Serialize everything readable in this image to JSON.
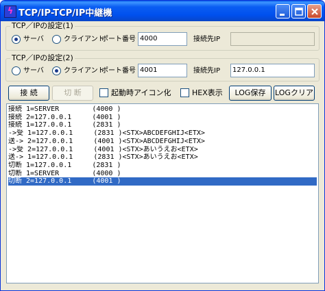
{
  "window": {
    "title": "TCP/IP-TCP/IP中継機",
    "icon": "app-lightning-icon"
  },
  "group1": {
    "legend": "TCP／IPの設定(1)",
    "server_label": "サーバ",
    "client_label": "クライアント",
    "selected": "server",
    "port_label": "ポート番号",
    "port_value": "4000",
    "dest_label": "接続先IP",
    "dest_value": ""
  },
  "group2": {
    "legend": "TCP／IPの設定(2)",
    "server_label": "サーバ",
    "client_label": "クライアント",
    "selected": "client",
    "port_label": "ポート番号",
    "port_value": "4001",
    "dest_label": "接続先IP",
    "dest_value": "127.0.0.1"
  },
  "toolbar": {
    "connect_label": "接 続",
    "disconnect_label": "切 断",
    "startup_icon_label": "起動時アイコン化",
    "startup_icon_checked": false,
    "hex_label": "HEX表示",
    "hex_checked": false,
    "log_save_label": "LOG保存",
    "log_clear_label": "LOGクリア"
  },
  "log": [
    "接続 1=SERVER        (4000 )",
    "接続 2=127.0.0.1     (4001 )",
    "接続 1=127.0.0.1     (2831 )",
    "->受 1=127.0.0.1     (2831 )<STX>ABCDEFGHIJ<ETX>",
    "送-> 2=127.0.0.1     (4001 )<STX>ABCDEFGHIJ<ETX>",
    "->受 2=127.0.0.1     (4001 )<STX>あいうえお<ETX>",
    "送-> 1=127.0.0.1     (2831 )<STX>あいうえお<ETX>",
    "切断 1=127.0.0.1     (2831 )",
    "切断 1=SERVER        (4000 )",
    "切断 2=127.0.0.1     (4001 )"
  ],
  "log_selected_index": 9,
  "colors": {
    "titlebar": "#0054e3",
    "selection": "#316ac5",
    "face": "#ece9d8"
  }
}
